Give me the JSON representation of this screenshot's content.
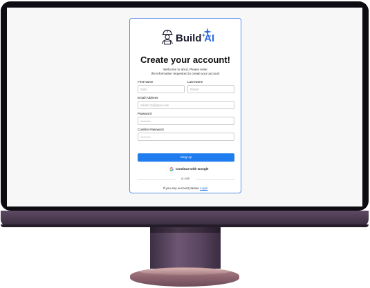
{
  "brand": {
    "name_part1": "Build",
    "name_part2": "AI"
  },
  "page": {
    "title": "Create your account!",
    "subtitle_line1": "Welcome to abcd, Please enter",
    "subtitle_line2": "the information requested to create your account"
  },
  "form": {
    "first_name": {
      "label": "First Name",
      "placeholder": "Sofia"
    },
    "last_name": {
      "label": "Last Name",
      "placeholder": "Robert"
    },
    "email": {
      "label": "Email Address",
      "placeholder": "sofiarb.11@gmail.com"
    },
    "password": {
      "label": "Password",
      "placeholder": "••••••••••"
    },
    "confirm_password": {
      "label": "Confirm Password",
      "placeholder": "••••••••••"
    }
  },
  "actions": {
    "signup_label": "Sing Up",
    "google_label": "Continue with Google",
    "divider_text": "or with"
  },
  "footer": {
    "prompt": "If you any account please",
    "login_label": "Login"
  },
  "colors": {
    "accent": "#1f7df0",
    "card_border": "#5b8ee6",
    "brand_ai": "#2a6be0"
  },
  "icons": [
    "builder-avatar-icon",
    "sparkle-icon",
    "google-icon"
  ]
}
